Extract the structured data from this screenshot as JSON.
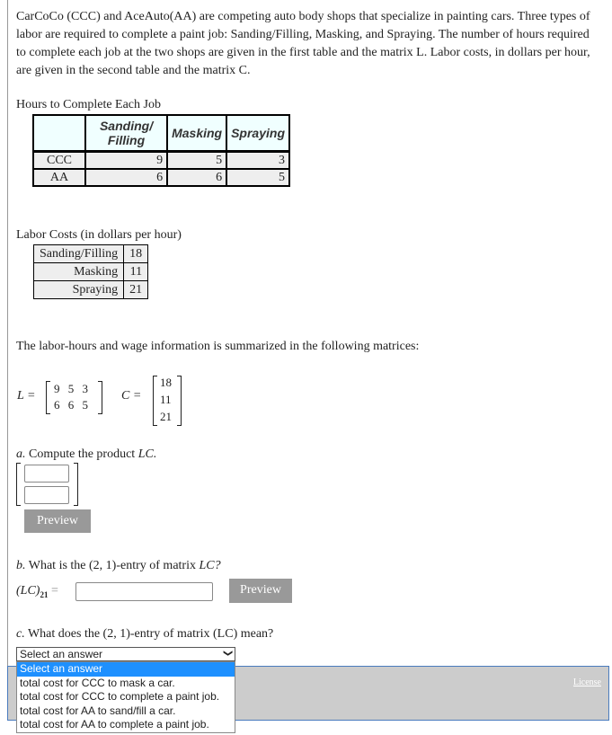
{
  "intro": "CarCoCo (CCC) and AceAuto(AA) are competing auto body shops that specialize in painting cars. Three types of labor are required to complete a paint job: Sanding/Filling, Masking, and Spraying. The number of hours required to complete each job at the two shops are given in the first table and the matrix L. Labor costs, in dollars per hour, are given in the second table and the matrix C.",
  "hours": {
    "title": "Hours to Complete Each Job",
    "headers": [
      "Sanding/ Filling",
      "Masking",
      "Spraying"
    ],
    "rows": [
      {
        "label": "CCC",
        "values": [
          "9",
          "5",
          "3"
        ]
      },
      {
        "label": "AA",
        "values": [
          "6",
          "6",
          "5"
        ]
      }
    ]
  },
  "labor": {
    "title": "Labor Costs (in dollars per hour)",
    "rows": [
      {
        "label": "Sanding/Filling",
        "value": "18"
      },
      {
        "label": "Masking",
        "value": "11"
      },
      {
        "label": "Spraying",
        "value": "21"
      }
    ]
  },
  "summary": "The labor-hours and wage information is summarized in the following matrices:",
  "matrices": {
    "L_label": "L =",
    "L": [
      [
        "9",
        "5",
        "3"
      ],
      [
        "6",
        "6",
        "5"
      ]
    ],
    "C_label": "C =",
    "C": [
      "18",
      "11",
      "21"
    ]
  },
  "part_a": {
    "prefix": "a.",
    "text": "Compute the product",
    "math": "LC.",
    "inputs": [
      "",
      ""
    ],
    "preview": "Preview"
  },
  "part_b": {
    "prefix": "b.",
    "text": "What is the (2, 1)-entry of matrix",
    "math": "LC?",
    "lhs": "(LC)",
    "sub": "21",
    "eq": "=",
    "value": "",
    "preview": "Preview"
  },
  "part_c": {
    "prefix": "c.",
    "text": "What does the (2, 1)-entry of matrix (LC) mean?",
    "selected": "Select an answer",
    "options": [
      "Select an answer",
      "total cost for CCC to mask a car.",
      "total cost for CCC to complete a paint job.",
      "total cost for AA to sand/fill a car.",
      "total cost for AA to complete a paint job."
    ]
  },
  "footer": {
    "license": "License"
  },
  "colors": {
    "button": "#999999",
    "highlight": "#1e90ff",
    "footer_bg": "#cccccc",
    "header_bg": "#f0ffff"
  }
}
